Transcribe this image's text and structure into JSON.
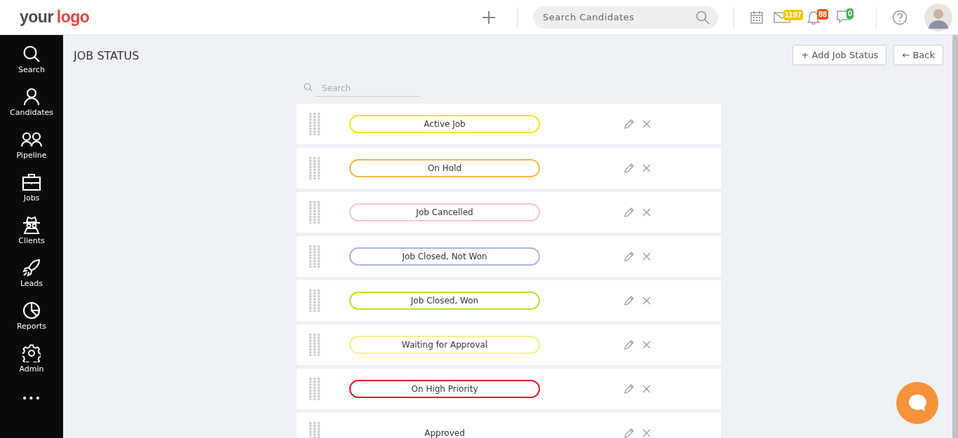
{
  "header": {
    "logo": {
      "part_1": "your",
      "part_2": "logo"
    },
    "search": {
      "placeholder": "Search Candidates"
    },
    "badges": [
      {
        "kind": "mail",
        "count": "1197",
        "color": "#f5c400"
      },
      {
        "kind": "bell",
        "count": "88",
        "color": "#e8531f"
      },
      {
        "kind": "chat",
        "count": "0",
        "color": "#3fb34f"
      }
    ]
  },
  "sidebar": {
    "items": [
      {
        "kind": "search",
        "label": "Search"
      },
      {
        "kind": "person",
        "label": "Candidates"
      },
      {
        "kind": "people",
        "label": "Pipeline"
      },
      {
        "kind": "briefcase",
        "label": "Jobs"
      },
      {
        "kind": "spy",
        "label": "Clients"
      },
      {
        "kind": "rocket",
        "label": "Leads"
      },
      {
        "kind": "pie",
        "label": "Reports"
      },
      {
        "kind": "gear",
        "label": "Admin"
      }
    ],
    "more": "•••"
  },
  "page": {
    "title": "JOB STATUS",
    "buttons": [
      "+ Add Job Status",
      "← Back"
    ],
    "search": {
      "placeholder": "Search"
    },
    "statuses": [
      {
        "label": "Active Job",
        "color": "#f2ec00"
      },
      {
        "label": "On Hold",
        "color": "#f2b84b"
      },
      {
        "label": "Job Cancelled",
        "color": "#f7c4c8"
      },
      {
        "label": "Job Closed, Not Won",
        "color": "#a9b6e6"
      },
      {
        "label": "Job Closed, Won",
        "color": "#aee62a"
      },
      {
        "label": "Waiting for Approval",
        "color": "#f7f08a"
      },
      {
        "label": "On High Priority",
        "color": "#e8102a"
      },
      {
        "label": "Approved",
        "color": "#ffffff"
      }
    ]
  }
}
